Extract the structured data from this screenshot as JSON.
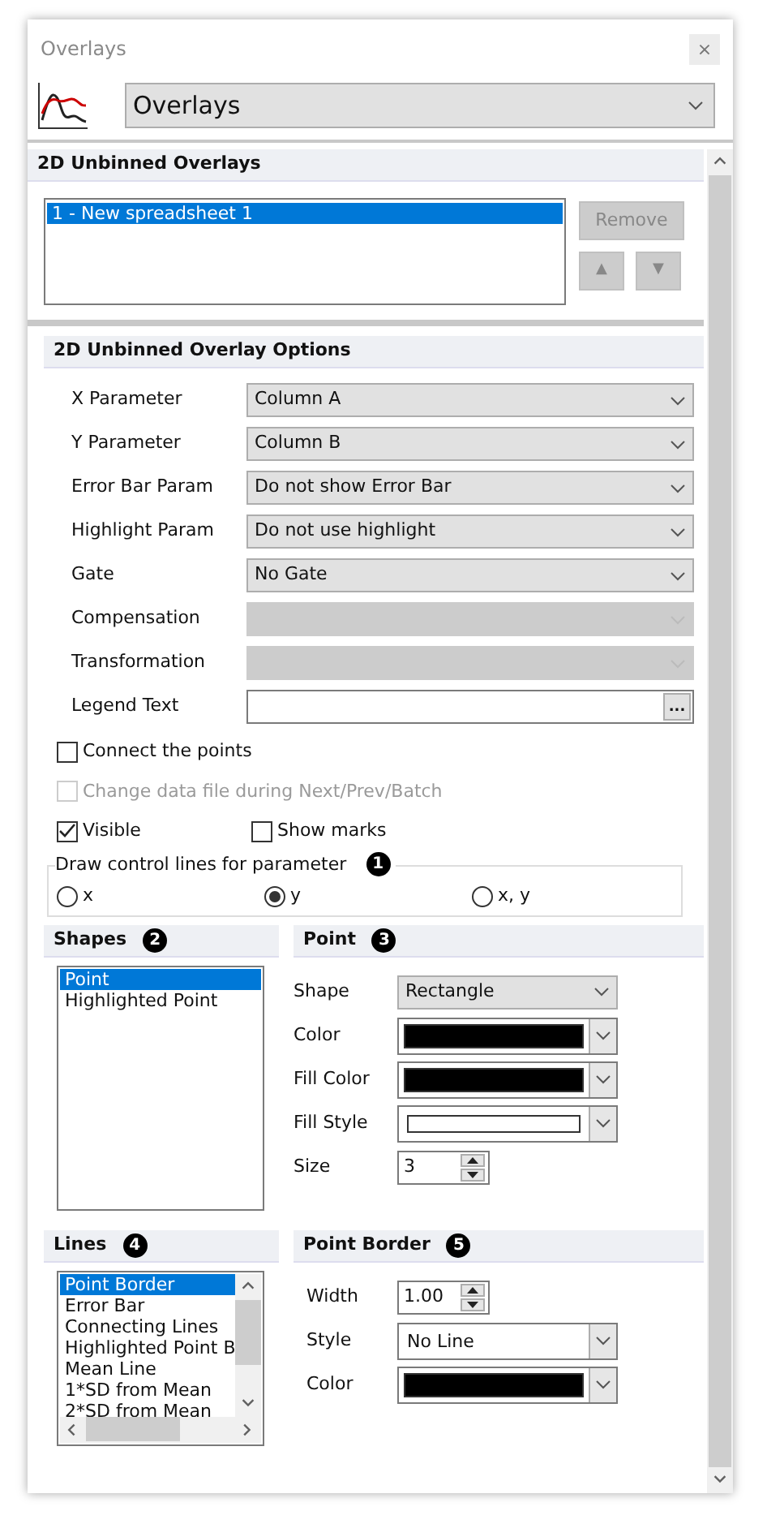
{
  "window": {
    "title": "Overlays",
    "close": "×"
  },
  "header": {
    "selector": "Overlays"
  },
  "overlays_section": {
    "title": "2D Unbinned Overlays",
    "items": [
      {
        "label": "1 - New spreadsheet 1",
        "selected": true
      }
    ],
    "remove_button": {
      "label": "Remove",
      "disabled": true
    },
    "up_button": "▲",
    "down_button": "▼"
  },
  "options_section": {
    "title": "2D Unbinned Overlay Options",
    "fields": [
      {
        "kind": "dropdown",
        "label": "X Parameter",
        "value": "Column A",
        "disabled": false
      },
      {
        "kind": "dropdown",
        "label": "Y Parameter",
        "value": "Column B",
        "disabled": false
      },
      {
        "kind": "dropdown",
        "label": "Error Bar Param",
        "value": "Do not show Error Bar",
        "disabled": false
      },
      {
        "kind": "dropdown",
        "label": "Highlight Param",
        "value": "Do not use highlight",
        "disabled": false
      },
      {
        "kind": "dropdown",
        "label": "Gate",
        "value": "No Gate",
        "disabled": false
      },
      {
        "kind": "dropdown",
        "label": "Compensation",
        "disabled": true
      },
      {
        "kind": "dropdown",
        "label": "Transformation",
        "disabled": true
      },
      {
        "kind": "text",
        "label": "Legend Text",
        "button": "..."
      }
    ],
    "checkboxes": [
      {
        "label": "Connect the points",
        "checked": false,
        "disabled": false
      },
      {
        "label": "Change data file during Next/Prev/Batch",
        "checked": false,
        "disabled": true
      },
      {
        "label": "Visible",
        "checked": true,
        "disabled": false
      },
      {
        "label": "Show marks",
        "checked": false,
        "disabled": false
      }
    ],
    "control_lines": {
      "title": "Draw control lines for parameter",
      "badge": "1",
      "options": [
        {
          "label": "x",
          "selected": false
        },
        {
          "label": "y",
          "selected": true
        },
        {
          "label": "x, y",
          "selected": false
        }
      ]
    }
  },
  "shapes": {
    "title": "Shapes",
    "badge": "2",
    "items": [
      {
        "label": "Point",
        "selected": true
      },
      {
        "label": "Highlighted Point",
        "selected": false
      }
    ]
  },
  "point": {
    "title": "Point",
    "badge": "3",
    "fields": [
      {
        "kind": "dropdown",
        "label": "Shape",
        "value": "Rectangle"
      },
      {
        "kind": "color",
        "label": "Color",
        "color": "#000000"
      },
      {
        "kind": "color",
        "label": "Fill Color",
        "color": "#000000"
      },
      {
        "kind": "fill",
        "label": "Fill Style",
        "color": "#ffffff"
      },
      {
        "kind": "spin",
        "label": "Size",
        "value": "3"
      }
    ]
  },
  "lines": {
    "title": "Lines",
    "badge": "4",
    "items": [
      {
        "label": "Point Border",
        "selected": true
      },
      {
        "label": "Error Bar",
        "selected": false
      },
      {
        "label": "Connecting Lines",
        "selected": false
      },
      {
        "label": "Highlighted Point B",
        "selected": false
      },
      {
        "label": "Mean Line",
        "selected": false
      },
      {
        "label": "1*SD from Mean",
        "selected": false
      },
      {
        "label": "2*SD from Mean",
        "selected": false
      }
    ]
  },
  "point_border": {
    "title": "Point Border",
    "badge": "5",
    "fields": [
      {
        "kind": "spin",
        "label": "Width",
        "value": "1.00"
      },
      {
        "kind": "select",
        "label": "Style",
        "value": "No Line"
      },
      {
        "kind": "color",
        "label": "Color",
        "color": "#000000"
      }
    ]
  }
}
